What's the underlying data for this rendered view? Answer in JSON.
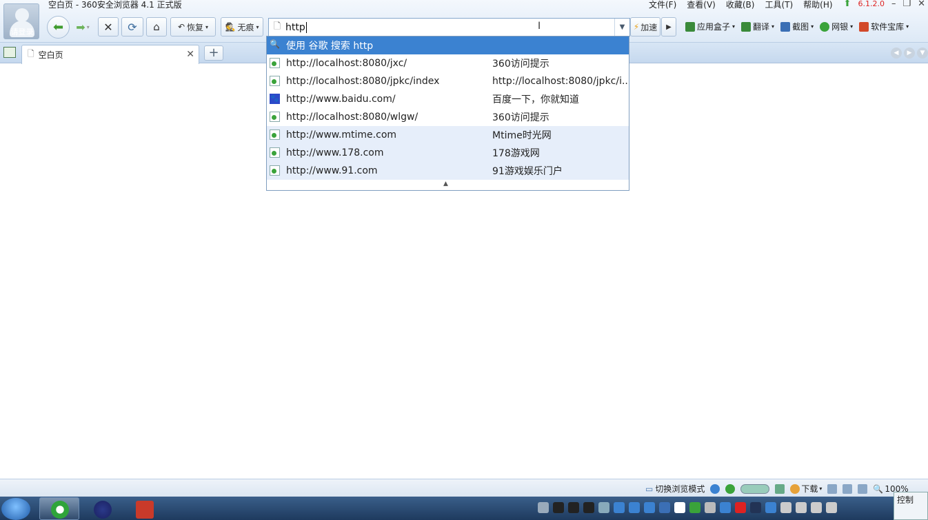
{
  "window": {
    "title": "空白页 - 360安全浏览器 4.1 正式版",
    "login_label": "请登录",
    "menus": [
      "文件(F)",
      "查看(V)",
      "收藏(B)",
      "工具(T)",
      "帮助(H)"
    ],
    "version_badge": "6.1.2.0"
  },
  "toolbar": {
    "restore_label": "恢复",
    "incognito_label": "无痕",
    "accelerate_label": "加速",
    "right_tools": [
      {
        "label": "应用盒子",
        "color": "#3a8a3a"
      },
      {
        "label": "翻译",
        "color": "#3a8a3a"
      },
      {
        "label": "截图",
        "color": "#3b6fb5"
      },
      {
        "label": "网银",
        "color": "#3aa33a"
      },
      {
        "label": "软件宝库",
        "color": "#d2492a"
      }
    ]
  },
  "address_bar": {
    "value": "http"
  },
  "tabs": [
    {
      "title": "空白页",
      "active": true
    }
  ],
  "suggestions": {
    "search_label": "使用 谷歌 搜索 http",
    "items": [
      {
        "url": "http://localhost:8080/jxc/",
        "title": "360访问提示",
        "icon": "page-icon",
        "kind": "typed"
      },
      {
        "url": "http://localhost:8080/jpkc/index",
        "title": "http://localhost:8080/jpkc/i...",
        "icon": "page-icon",
        "kind": "typed"
      },
      {
        "url": "http://www.baidu.com/",
        "title": "百度一下，你就知道",
        "icon": "baidu-paw-icon",
        "kind": "typed"
      },
      {
        "url": "http://localhost:8080/wlgw/",
        "title": "360访问提示",
        "icon": "page-icon",
        "kind": "typed"
      },
      {
        "url": "http://www.mtime.com",
        "title": "Mtime时光网",
        "icon": "page-icon",
        "kind": "history"
      },
      {
        "url": "http://www.178.com",
        "title": "178游戏网",
        "icon": "page-icon",
        "kind": "history"
      },
      {
        "url": "http://www.91.com",
        "title": "91游戏娱乐门户",
        "icon": "page-icon",
        "kind": "history"
      }
    ]
  },
  "status_bar": {
    "mode_label": "切换浏览模式",
    "download_label": "下载",
    "zoom_label": "100%"
  },
  "taskbar": {
    "clock_label": "控制"
  },
  "colors": {
    "selection": "#3b82d1",
    "history_row": "#e6eefa"
  }
}
